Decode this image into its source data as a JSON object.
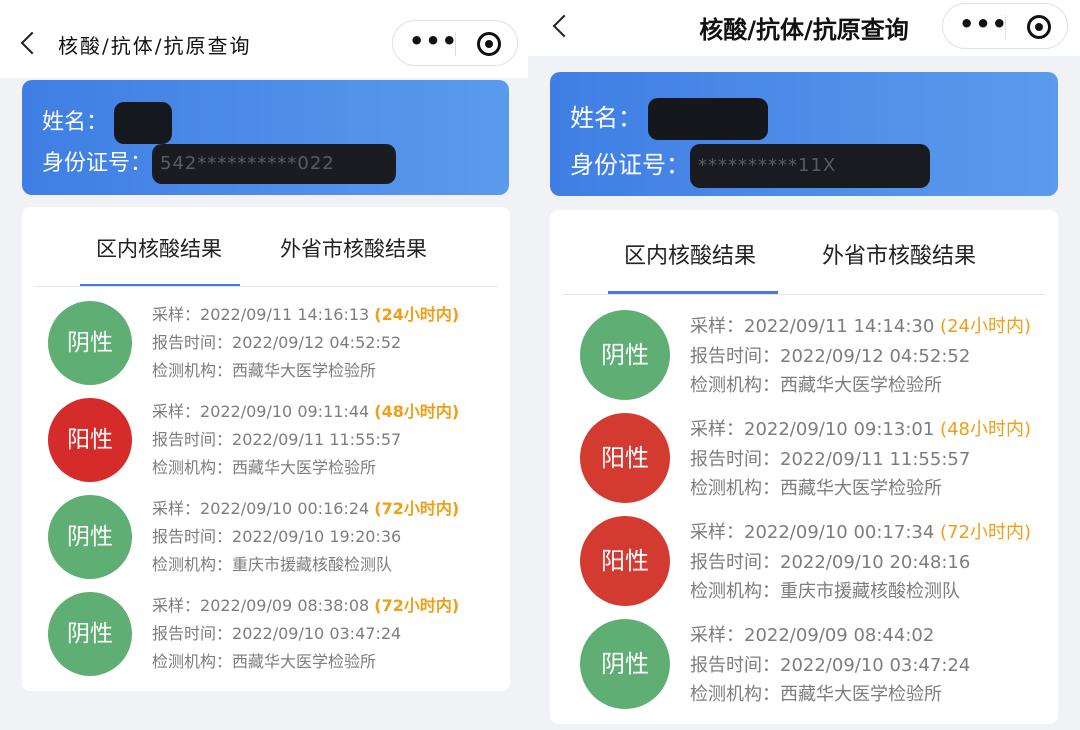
{
  "left": {
    "nav": {
      "title": "核酸/抗体/抗原查询",
      "more_glyph": "•••"
    },
    "person": {
      "name_label": "姓名：",
      "name_value": "",
      "id_label": "身份证号：",
      "id_value": "542**********022"
    },
    "tabs": [
      {
        "label": "区内核酸结果"
      },
      {
        "label": "外省市核酸结果"
      }
    ],
    "records": [
      {
        "result": "阴性",
        "sample_label": "采样：",
        "sample_time": "2022/09/11 14:16:13",
        "window": "(24小时内)",
        "report_label": "报告时间：",
        "report_time": "2022/09/12 04:52:52",
        "org_label": "检测机构：",
        "org": "西藏华大医学检验所"
      },
      {
        "result": "阳性",
        "sample_label": "采样：",
        "sample_time": "2022/09/10 09:11:44",
        "window": "(48小时内)",
        "report_label": "报告时间：",
        "report_time": "2022/09/11 11:55:57",
        "org_label": "检测机构：",
        "org": "西藏华大医学检验所"
      },
      {
        "result": "阴性",
        "sample_label": "采样：",
        "sample_time": "2022/09/10 00:16:24",
        "window": "(72小时内)",
        "report_label": "报告时间：",
        "report_time": "2022/09/10 19:20:36",
        "org_label": "检测机构：",
        "org": "重庆市援藏核酸检测队"
      },
      {
        "result": "阴性",
        "sample_label": "采样：",
        "sample_time": "2022/09/09 08:38:08",
        "window": "(72小时内)",
        "report_label": "报告时间：",
        "report_time": "2022/09/10 03:47:24",
        "org_label": "检测机构：",
        "org": "西藏华大医学检验所"
      }
    ]
  },
  "right": {
    "nav": {
      "title": "核酸/抗体/抗原查询",
      "more_glyph": "•••"
    },
    "person": {
      "name_label": "姓名：",
      "name_value": "",
      "id_label": "身份证号：",
      "id_value": "**********11X"
    },
    "tabs": [
      {
        "label": "区内核酸结果"
      },
      {
        "label": "外省市核酸结果"
      }
    ],
    "records": [
      {
        "result": "阴性",
        "sample_label": "采样：",
        "sample_time": "2022/09/11 14:14:30",
        "window": "(24小时内)",
        "report_label": "报告时间：",
        "report_time": "2022/09/12 04:52:52",
        "org_label": "检测机构：",
        "org": "西藏华大医学检验所"
      },
      {
        "result": "阳性",
        "sample_label": "采样：",
        "sample_time": "2022/09/10 09:13:01",
        "window": "(48小时内)",
        "report_label": "报告时间：",
        "report_time": "2022/09/11 11:55:57",
        "org_label": "检测机构：",
        "org": "西藏华大医学检验所"
      },
      {
        "result": "阳性",
        "sample_label": "采样：",
        "sample_time": "2022/09/10 00:17:34",
        "window": "(72小时内)",
        "report_label": "报告时间：",
        "report_time": "2022/09/10 20:48:16",
        "org_label": "检测机构：",
        "org": "重庆市援藏核酸检测队"
      },
      {
        "result": "阴性",
        "sample_label": "采样：",
        "sample_time": "2022/09/09 08:44:02",
        "window": "",
        "report_label": "报告时间：",
        "report_time": "2022/09/10 03:47:24",
        "org_label": "检测机构：",
        "org": "西藏华大医学检验所"
      }
    ]
  },
  "colors": {
    "header_blue": "#4a87e6",
    "negative": "#5fae73",
    "positive": "#d62b2b",
    "window_tag": "#ef9f15",
    "tab_underline": "#4a78df"
  }
}
